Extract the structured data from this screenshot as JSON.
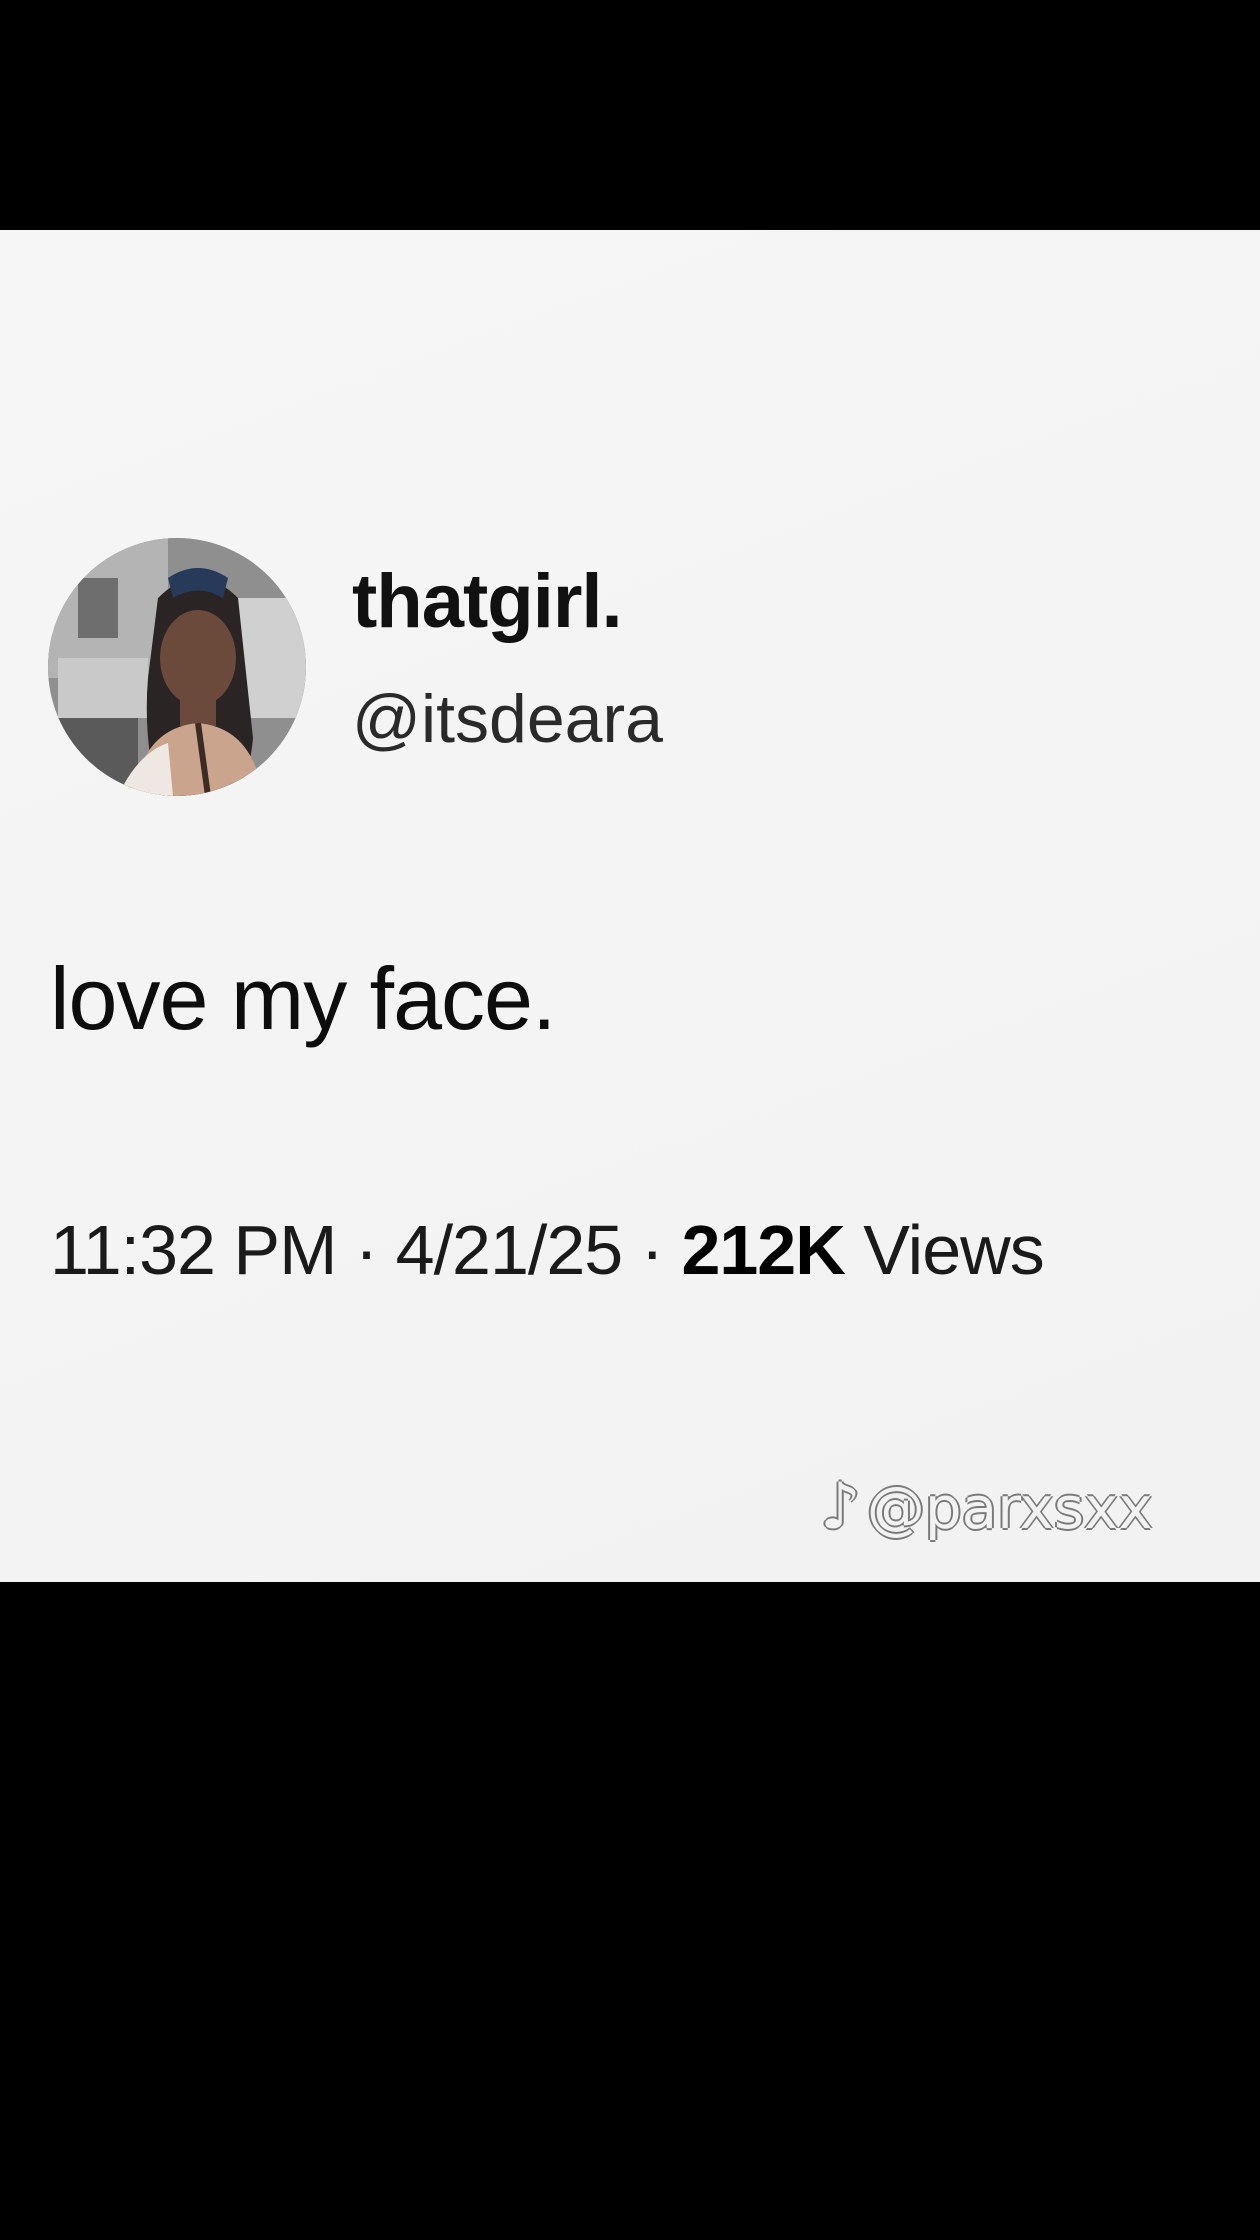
{
  "tweet": {
    "display_name": "thatgirl.",
    "handle": "@itsdeara",
    "text": "love my face.",
    "time": "11:32 PM",
    "separator": "·",
    "date": "4/21/25",
    "views_count": "212K",
    "views_label": "Views",
    "avatar_icon": "profile-photo"
  },
  "watermark": {
    "icon": "tiktok-icon",
    "text": "@parxsxx"
  },
  "colors": {
    "card_background": "#f5f5f5",
    "letterbox": "#000000",
    "text_primary": "#111111"
  }
}
